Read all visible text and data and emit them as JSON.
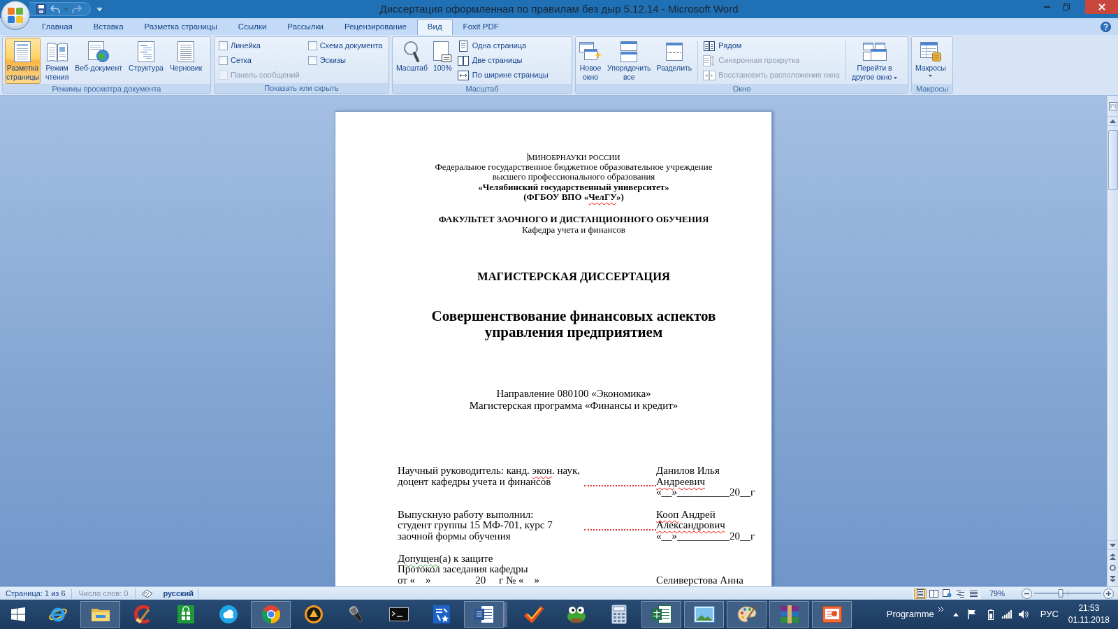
{
  "window": {
    "title": "Диссертация оформленная по правилам без дыр 5.12.14 - Microsoft Word"
  },
  "tabs": [
    {
      "label": "Главная",
      "selected": false
    },
    {
      "label": "Вставка",
      "selected": false
    },
    {
      "label": "Разметка страницы",
      "selected": false
    },
    {
      "label": "Ссылки",
      "selected": false
    },
    {
      "label": "Рассылки",
      "selected": false
    },
    {
      "label": "Рецензирование",
      "selected": false
    },
    {
      "label": "Вид",
      "selected": true
    },
    {
      "label": "Foxit PDF",
      "selected": false
    }
  ],
  "ribbon": {
    "groups": [
      {
        "label": "Режимы просмотра документа",
        "items": [
          {
            "kind": "large",
            "label": "Разметка\nстраницы",
            "selected": true,
            "disabled": false,
            "dropdown": false
          },
          {
            "kind": "large",
            "label": "Режим\nчтения",
            "selected": false,
            "disabled": false,
            "dropdown": false
          },
          {
            "kind": "large",
            "label": "Веб-документ",
            "selected": false,
            "disabled": false,
            "dropdown": false
          },
          {
            "kind": "large",
            "label": "Структура",
            "selected": false,
            "disabled": false,
            "dropdown": false
          },
          {
            "kind": "large",
            "label": "Черновик",
            "selected": false,
            "disabled": false,
            "dropdown": false
          }
        ]
      },
      {
        "label": "Показать или скрыть",
        "items": [
          {
            "kind": "checkbox",
            "label": "Линейка",
            "checked": false,
            "disabled": false
          },
          {
            "kind": "checkbox",
            "label": "Сетка",
            "checked": false,
            "disabled": false
          },
          {
            "kind": "checkbox",
            "label": "Панель сообщений",
            "checked": false,
            "disabled": true
          },
          {
            "kind": "checkbox",
            "label": "Схема документа",
            "checked": false,
            "disabled": false
          },
          {
            "kind": "checkbox",
            "label": "Эскизы",
            "checked": false,
            "disabled": false
          }
        ]
      },
      {
        "label": "Масштаб",
        "items": [
          {
            "kind": "large",
            "label": "Масштаб",
            "disabled": false,
            "dropdown": false
          },
          {
            "kind": "large",
            "label": "100%",
            "disabled": false,
            "dropdown": false
          },
          {
            "kind": "small",
            "label": "Одна страница",
            "disabled": false
          },
          {
            "kind": "small",
            "label": "Две страницы",
            "disabled": false
          },
          {
            "kind": "small",
            "label": "По ширине страницы",
            "disabled": false
          }
        ]
      },
      {
        "label": "Окно",
        "items": [
          {
            "kind": "large",
            "label": "Новое\nокно",
            "disabled": false,
            "dropdown": false
          },
          {
            "kind": "large",
            "label": "Упорядочить\nвсе",
            "disabled": false,
            "dropdown": false
          },
          {
            "kind": "large",
            "label": "Разделить",
            "disabled": false,
            "dropdown": false
          },
          {
            "kind": "small",
            "label": "Рядом",
            "disabled": false
          },
          {
            "kind": "small",
            "label": "Синхронная прокрутка",
            "disabled": true
          },
          {
            "kind": "small",
            "label": "Восстановить расположение окна",
            "disabled": true
          },
          {
            "kind": "large",
            "label": "Перейти в\nдругое окно",
            "disabled": false,
            "dropdown": true
          }
        ]
      },
      {
        "label": "Макросы",
        "items": [
          {
            "kind": "large",
            "label": "Макросы",
            "disabled": false,
            "dropdown": true
          }
        ]
      }
    ]
  },
  "document": {
    "lines": [
      {
        "kind": "ministry",
        "text": "МИНОБРНАУКИ РОССИИ",
        "cursor": true
      },
      {
        "kind": "org",
        "text": "Федеральное государственное бюджетное образовательное учреждение",
        "cursor": false
      },
      {
        "kind": "org",
        "text": "высшего профессионального образования",
        "cursor": false
      },
      {
        "kind": "university",
        "text": "«Челябинский государственный университет»",
        "cursor": false
      },
      {
        "kind": "university",
        "text": [
          {
            "text": "(ФГБОУ ВПО «",
            "kind": "plain"
          },
          {
            "text": "ЧелГУ",
            "kind": "spelling"
          },
          {
            "text": "»)",
            "kind": "plain"
          }
        ],
        "cursor": false
      },
      {
        "kind": "faculty",
        "text": "ФАКУЛЬТЕТ ЗАОЧНОГО И ДИСТАНЦИОННОГО ОБУЧЕНИЯ",
        "cursor": false
      },
      {
        "kind": "department",
        "text": "Кафедра учета и финансов",
        "cursor": false
      },
      {
        "kind": "doc_type",
        "text": "МАГИСТЕРСКАЯ ДИССЕРТАЦИЯ",
        "cursor": false
      },
      {
        "kind": "title",
        "text": "Совершенствование финансовых аспектов",
        "cursor": false
      },
      {
        "kind": "title",
        "text": "управления предприятием",
        "cursor": false
      },
      {
        "kind": "program",
        "text": "Направление 080100 «Экономика»",
        "cursor": false
      },
      {
        "kind": "program",
        "text": "Магистерская программа «Финансы и кредит»",
        "cursor": false
      }
    ],
    "signatories": [
      {
        "rows": [
          {
            "left": [
              {
                "text": "Научный руководитель: канд. ",
                "kind": "plain"
              },
              {
                "text": "экон",
                "kind": "spelling"
              },
              {
                "text": ". наук,",
                "kind": "plain"
              }
            ],
            "right": "Данилов Илья",
            "signature_line": false
          },
          {
            "left": "доцент кафедры учета и финансов",
            "right": [
              {
                "text": "Андреевич",
                "kind": "spelling"
              }
            ],
            "signature_line": true
          },
          {
            "right": "«__»__________20__г",
            "signature_line": false
          }
        ]
      },
      {
        "rows": [
          {
            "left": "Выпускную работу выполнил:",
            "right": [
              {
                "text": "Кооп",
                "kind": "spelling"
              },
              {
                "text": " Андрей",
                "kind": "plain"
              }
            ],
            "signature_line": false
          },
          {
            "left": "студент группы 15 МФ-701, курс 7",
            "right": [
              {
                "text": "Александрович",
                "kind": "spelling"
              }
            ],
            "signature_line": true
          },
          {
            "left": "заочной формы обучения",
            "right": "«__»__________20__г",
            "signature_line": false
          }
        ]
      },
      {
        "rows": [
          {
            "left": [
              {
                "text": "Допущен",
                "kind": "grammar"
              },
              {
                "text": "(а) к защите",
                "kind": "plain"
              }
            ],
            "signature_line": false
          },
          {
            "left": "Протокол заседания кафедры",
            "signature_line": false
          },
          {
            "left": "от «    »                 20     г № «    »",
            "right": "Селиверстова Анна",
            "signature_line": false
          }
        ]
      }
    ]
  },
  "status_bar": {
    "page_count": "Страница: 1 из 6",
    "word_count": "Число слов: 0",
    "language": "русский",
    "views": [
      {
        "selected": true
      },
      {
        "selected": false
      },
      {
        "selected": false
      },
      {
        "selected": false
      },
      {
        "selected": false
      }
    ],
    "zoom": {
      "reading": "79%",
      "level": 0.4
    }
  },
  "taskbar": {
    "apps": [
      {
        "open": false,
        "stacked": false
      },
      {
        "open": true,
        "stacked": false
      },
      {
        "open": false,
        "stacked": false
      },
      {
        "open": false,
        "stacked": false
      },
      {
        "open": false,
        "stacked": false
      },
      {
        "open": true,
        "stacked": false
      },
      {
        "open": false,
        "stacked": false
      },
      {
        "open": false,
        "stacked": false
      },
      {
        "open": false,
        "stacked": false
      },
      {
        "open": false,
        "stacked": false
      },
      {
        "open": true,
        "stacked": true
      },
      {
        "open": false,
        "stacked": false
      },
      {
        "open": false,
        "stacked": false
      },
      {
        "open": false,
        "stacked": false
      },
      {
        "open": true,
        "stacked": false
      },
      {
        "open": true,
        "stacked": false
      },
      {
        "open": true,
        "stacked": false
      },
      {
        "open": true,
        "stacked": false
      },
      {
        "open": true,
        "stacked": false
      }
    ],
    "toolbar": "Programme",
    "language": "РУС",
    "time": "21:53",
    "date": "01.11.2018"
  }
}
